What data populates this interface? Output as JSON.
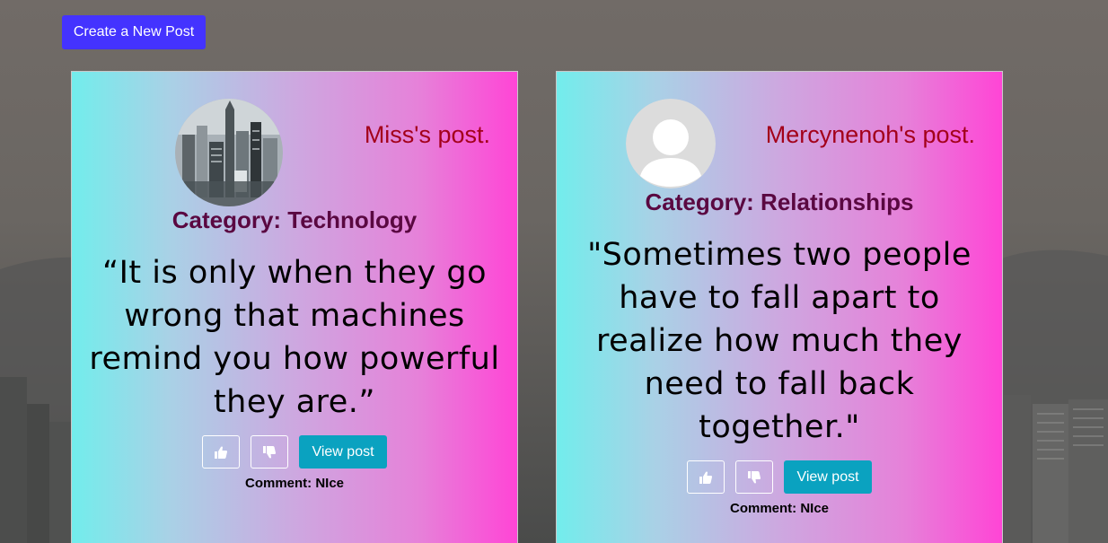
{
  "toolbar": {
    "create_label": "Create a New Post"
  },
  "posts": [
    {
      "owner": "Miss's post.",
      "category_prefix": "Category: ",
      "category": "Technology",
      "quote": "“It is only when they go wrong that machines remind you how powerful they are.”",
      "view_label": "View post",
      "comment_prefix": "Comment: ",
      "comment": "NIce",
      "avatar_icon": "city-photo-avatar",
      "like_icon": "thumbs-up-icon",
      "dislike_icon": "thumbs-down-icon"
    },
    {
      "owner": "Mercynenoh's post.",
      "category_prefix": "Category: ",
      "category": "Relationships",
      "quote": "\"Sometimes two people have to fall apart to realize how much they need to fall back together.\"",
      "view_label": "View post",
      "comment_prefix": "Comment: ",
      "comment": "NIce",
      "avatar_icon": "default-user-avatar",
      "like_icon": "thumbs-up-icon",
      "dislike_icon": "thumbs-down-icon"
    }
  ],
  "colors": {
    "create_button": "#4433ff",
    "view_button": "#0aa2c0",
    "owner_text": "#a3001a",
    "category_text": "#5a0841",
    "card_gradient_start": "#72edec",
    "card_gradient_end": "#ff45d6"
  }
}
